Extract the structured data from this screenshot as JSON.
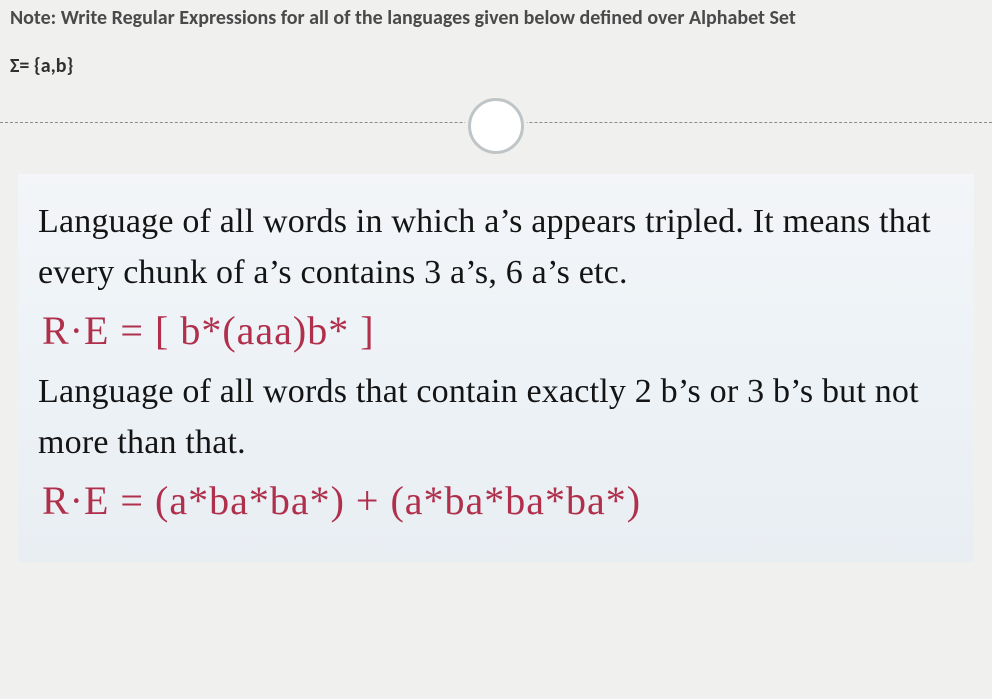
{
  "header": {
    "note": "Note: Write Regular Expressions for all of the languages given below defined over Alphabet Set",
    "sigma": "Σ= {a,b}"
  },
  "card": {
    "problem1_text": "Language of all words in which a’s appears tripled. It means that every chunk of a’s contains 3 a’s, 6 a’s etc.",
    "answer1": "R·E = [ b*(aaa)b* ]",
    "problem2_text": "Language of all words that contain exactly 2 b’s  or 3 b’s but not more than that.",
    "answer2": "R·E = (a*ba*ba*) + (a*ba*ba*ba*)"
  }
}
